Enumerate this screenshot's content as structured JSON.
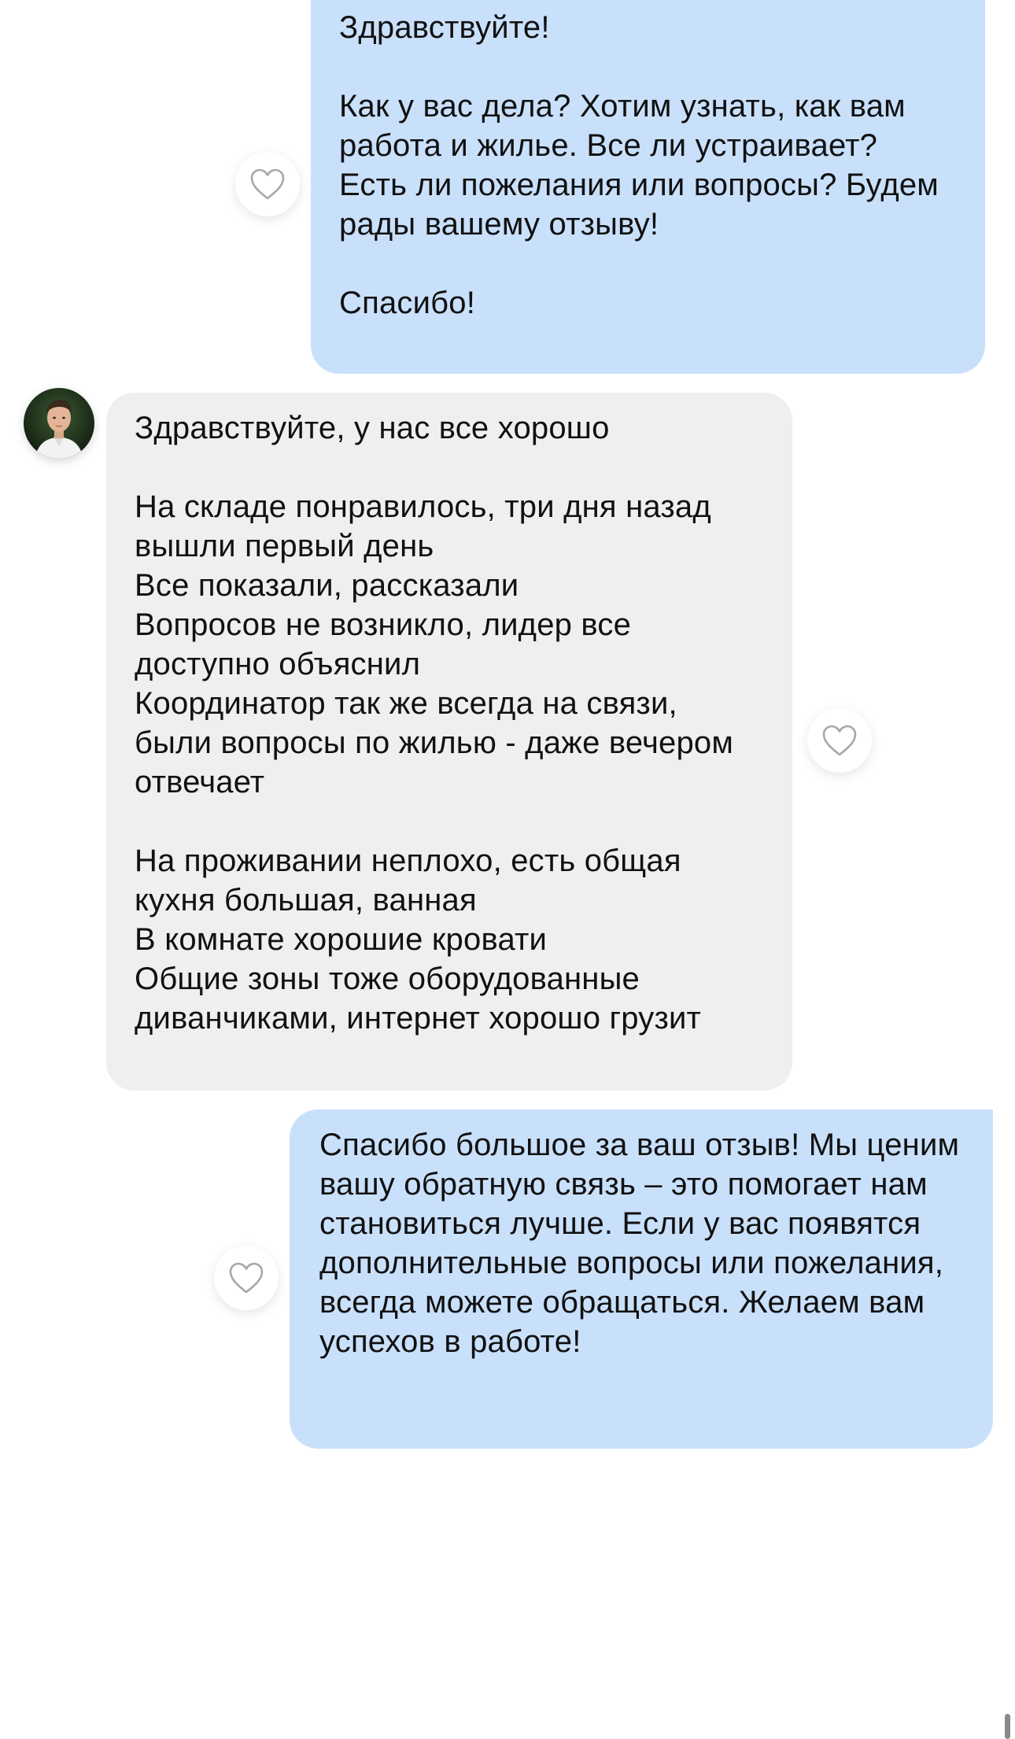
{
  "messages": [
    {
      "direction": "outgoing",
      "text": "Здравствуйте!\n\nКак у вас дела? Хотим узнать, как вам работа и жилье. Все ли устраивает? Есть ли пожелания или вопросы? Будем рады вашему отзыву!\n\nСпасибо!"
    },
    {
      "direction": "incoming",
      "text": "Здравствуйте, у нас все хорошо\n\nНа складе понравилось, три дня назад вышли первый день\nВсе показали, рассказали\nВопросов не возникло, лидер все доступно объяснил\nКоординатор так же всегда на связи, были вопросы по жилью - даже вечером отвечает\n\nНа проживании неплохо, есть общая кухня большая, ванная\nВ комнате хорошие кровати\nОбщие зоны тоже оборудованные диванчиками, интернет хорошо грузит"
    },
    {
      "direction": "outgoing",
      "text": "Спасибо большое за ваш отзыв! Мы ценим вашу обратную связь – это помогает нам становиться лучше. Если у вас появятся дополнительные вопросы или пожелания, всегда можете обращаться. Желаем вам успехов в работе!"
    }
  ],
  "icons": {
    "like": "heart-outline-icon",
    "avatar": "user-avatar"
  },
  "colors": {
    "outgoing_bubble": "#c9e0fb",
    "incoming_bubble": "#efefef",
    "background": "#ffffff",
    "heart_stroke": "#a8a8a8"
  }
}
